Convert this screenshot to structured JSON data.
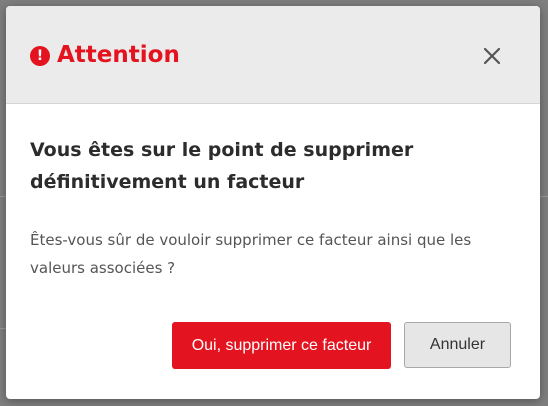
{
  "dialog": {
    "title": "Attention",
    "title_icon": "exclamation-circle-icon",
    "close_icon": "close-icon",
    "heading": "Vous êtes sur le point de supprimer définitivement un facteur",
    "message": "Êtes-vous sûr de vouloir supprimer ce facteur ainsi que les valeurs associées ?",
    "confirm_label": "Oui, supprimer ce facteur",
    "cancel_label": "Annuler"
  },
  "colors": {
    "accent": "#e3141f",
    "header_bg": "#ebebeb",
    "overlay": "#7f7f7f"
  }
}
